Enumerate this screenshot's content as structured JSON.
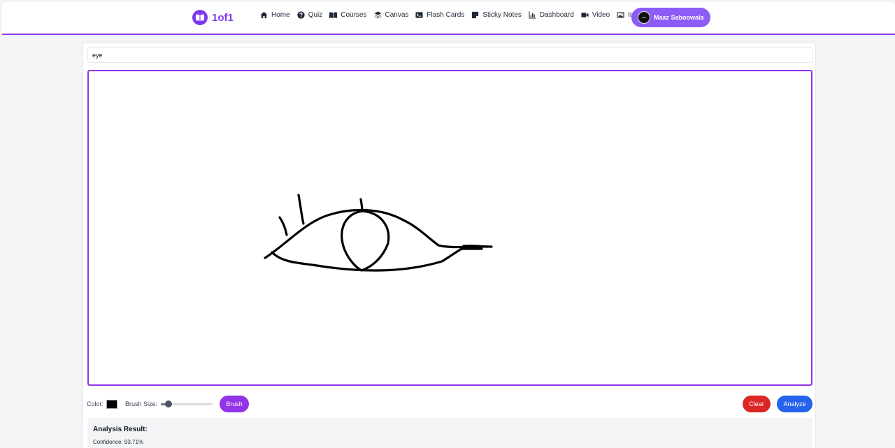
{
  "brand": {
    "name": "1of1",
    "color": "#7c3aed"
  },
  "nav": [
    {
      "label": "Home",
      "icon": "home-icon"
    },
    {
      "label": "Quiz",
      "icon": "question-icon"
    },
    {
      "label": "Courses",
      "icon": "book-icon"
    },
    {
      "label": "Canvas",
      "icon": "layers-icon"
    },
    {
      "label": "Flash Cards",
      "icon": "terminal-icon"
    },
    {
      "label": "Sticky Notes",
      "icon": "sticky-note-icon"
    },
    {
      "label": "Dashboard",
      "icon": "chart-icon"
    },
    {
      "label": "Video",
      "icon": "video-icon"
    },
    {
      "label": "Image",
      "icon": "image-icon"
    }
  ],
  "user": {
    "name": "Maaz Saboowala"
  },
  "canvas": {
    "word_value": "eye",
    "drawing_subject": "eye-sketch",
    "border_color": "#9333ea"
  },
  "controls": {
    "color_label": "Color:",
    "brush_color": "#000000",
    "brush_size_label": "Brush Size:",
    "brush_size_fraction": 0.1,
    "brush_button": "Brush",
    "clear_button": "Clear",
    "analyze_button": "Analyze"
  },
  "colors": {
    "accent": "#9333ea",
    "clear": "#dc2626",
    "analyze": "#2563eb"
  },
  "result": {
    "title": "Analysis Result:",
    "confidence_text": "Confidence: 93.71%"
  }
}
